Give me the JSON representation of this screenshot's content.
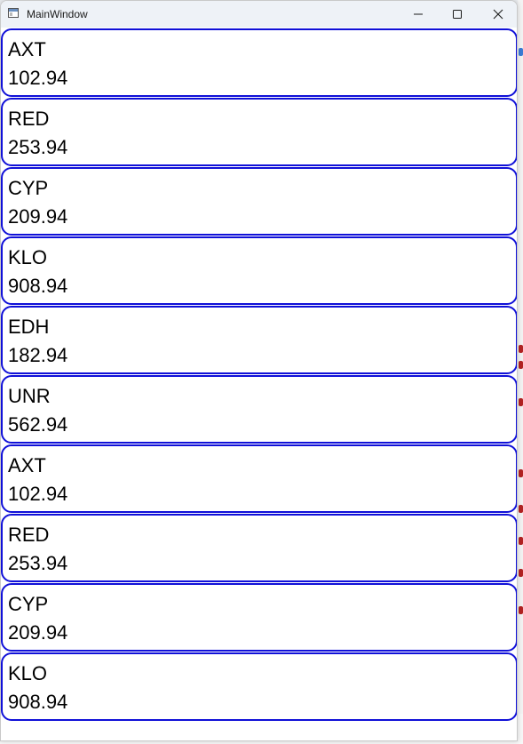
{
  "window": {
    "title": "MainWindow"
  },
  "tickers": [
    {
      "symbol": "AXT",
      "price": "102.94"
    },
    {
      "symbol": "RED",
      "price": "253.94"
    },
    {
      "symbol": "CYP",
      "price": "209.94"
    },
    {
      "symbol": "KLO",
      "price": "908.94"
    },
    {
      "symbol": "EDH",
      "price": "182.94"
    },
    {
      "symbol": "UNR",
      "price": "562.94"
    },
    {
      "symbol": "AXT",
      "price": "102.94"
    },
    {
      "symbol": "RED",
      "price": "253.94"
    },
    {
      "symbol": "CYP",
      "price": "209.94"
    },
    {
      "symbol": "KLO",
      "price": "908.94"
    }
  ],
  "colors": {
    "card_border": "#1010d8",
    "titlebar_bg": "#eef2f7"
  },
  "icons": {
    "app": "app-window-icon",
    "minimize": "minimize-icon",
    "maximize": "maximize-icon",
    "close": "close-icon"
  }
}
